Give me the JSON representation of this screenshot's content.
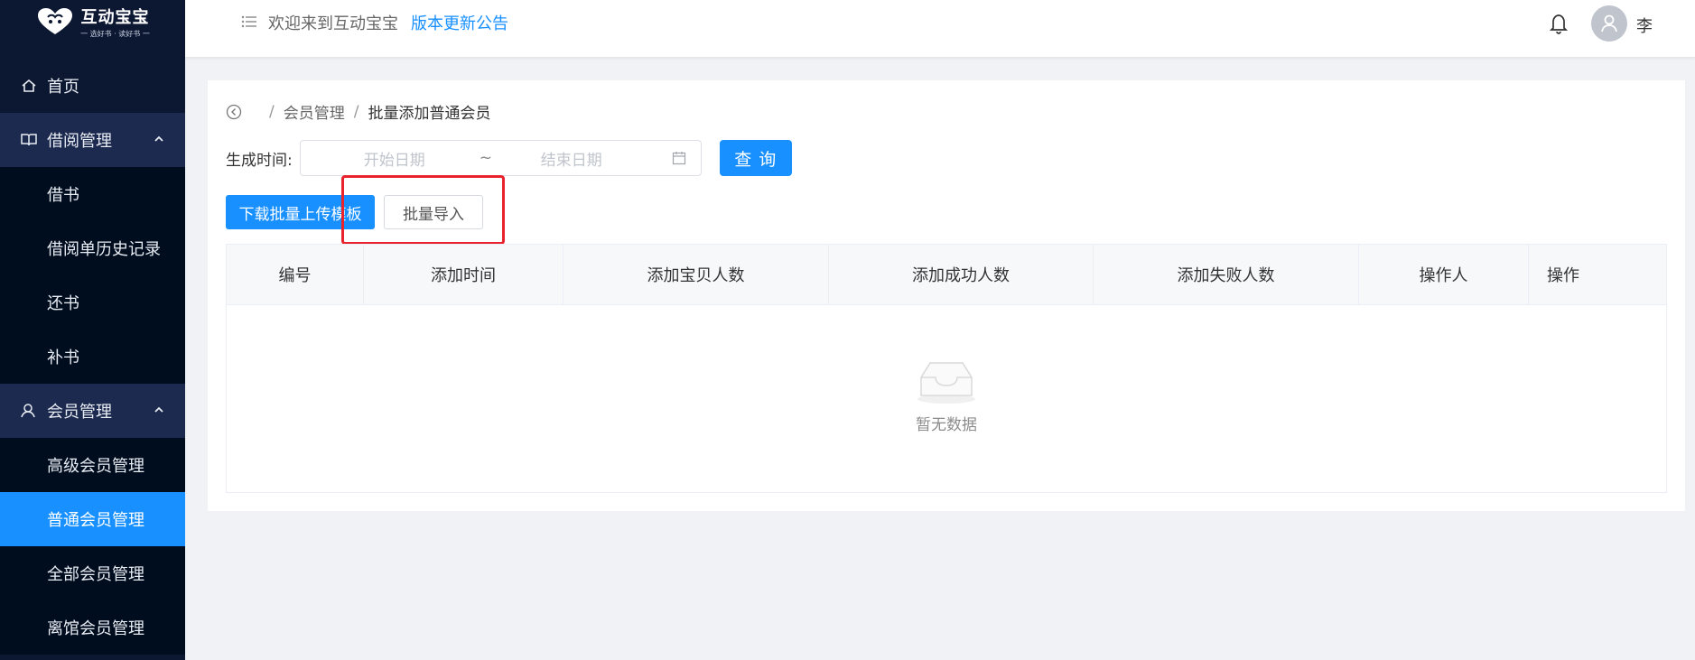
{
  "logo": {
    "title": "互动宝宝",
    "subtitle": "一 选好书 · 读好书 一"
  },
  "sidebar": {
    "items": [
      {
        "label": "首页",
        "icon": "home-icon",
        "kind": "top"
      },
      {
        "label": "借阅管理",
        "icon": "book-icon",
        "kind": "group",
        "expanded": true
      },
      {
        "label": "借书",
        "kind": "sub"
      },
      {
        "label": "借阅单历史记录",
        "kind": "sub"
      },
      {
        "label": "还书",
        "kind": "sub"
      },
      {
        "label": "补书",
        "kind": "sub"
      },
      {
        "label": "会员管理",
        "icon": "user-icon",
        "kind": "group",
        "expanded": true
      },
      {
        "label": "高级会员管理",
        "kind": "sub"
      },
      {
        "label": "普通会员管理",
        "kind": "sub",
        "active": true
      },
      {
        "label": "全部会员管理",
        "kind": "sub"
      },
      {
        "label": "离馆会员管理",
        "kind": "sub"
      }
    ]
  },
  "header": {
    "welcome": "欢迎来到互动宝宝",
    "notice_link": "版本更新公告",
    "username": "李"
  },
  "breadcrumb": {
    "parent": "会员管理",
    "current": "批量添加普通会员",
    "separator": "/"
  },
  "filter": {
    "label": "生成时间:",
    "start_placeholder": "开始日期",
    "range_separator": "~",
    "end_placeholder": "结束日期",
    "query_button": "查 询"
  },
  "actions": {
    "download_button": "下载批量上传模板",
    "import_button": "批量导入"
  },
  "table": {
    "columns": [
      "编号",
      "添加时间",
      "添加宝贝人数",
      "添加成功人数",
      "添加失败人数",
      "操作人",
      "操作"
    ],
    "rows": [],
    "empty_text": "暂无数据"
  },
  "colors": {
    "sidebar_bg": "#0c1732",
    "sidebar_group_bg": "#1c2a4f",
    "primary": "#1890ff",
    "highlight_box": "#e8232e"
  }
}
